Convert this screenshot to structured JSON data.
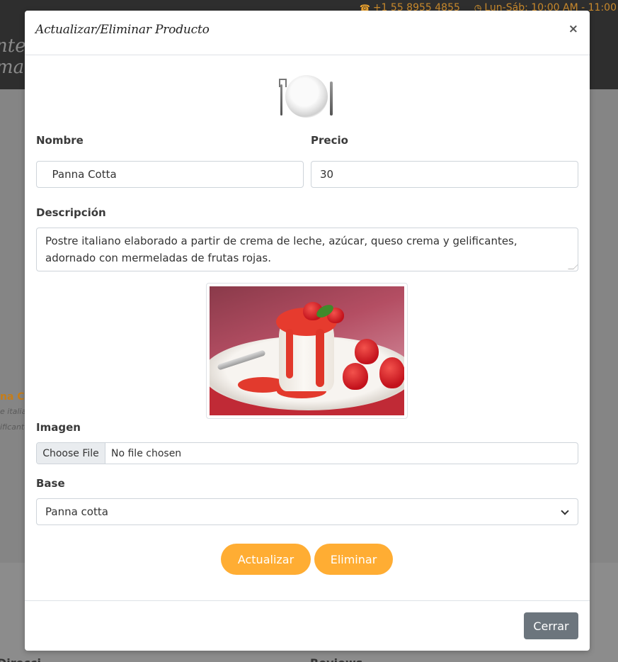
{
  "background": {
    "topbar": {
      "phone": "+1 55 8955 4855",
      "hours": "Lun-Sáb: 10:00 AM - 11:00"
    },
    "logo_line1": "nte",
    "logo_line2": "ma",
    "card": {
      "title": "na C",
      "desc_line1": "e italia",
      "desc_line2": "ificante"
    },
    "footer": {
      "col1": "Direcci",
      "col2": "Reviews"
    }
  },
  "modal": {
    "title": "Actualizar/Eliminar Producto",
    "close_symbol": "×",
    "fields": {
      "nombre_label": "Nombre",
      "nombre_value": "  Panna Cotta",
      "precio_label": "Precio",
      "precio_value": "30",
      "descripcion_label": "Descripción",
      "descripcion_value": "Postre italiano elaborado a partir de crema de leche, azúcar, queso crema y gelificantes, adornado con mermeladas de frutas rojas.",
      "imagen_label": "Imagen",
      "file_button": "Choose File",
      "file_status": "No file chosen",
      "base_label": "Base",
      "base_value": "Panna cotta"
    },
    "buttons": {
      "update": "Actualizar",
      "delete": "Eliminar",
      "close": "Cerrar"
    }
  },
  "icons": {
    "header_icon": "plate-cutlery-icon",
    "phone_icon": "phone-icon",
    "clock_icon": "clock-icon"
  },
  "colors": {
    "accent": "#ffad33",
    "secondary": "#6c757d",
    "overlay": "#858585"
  }
}
